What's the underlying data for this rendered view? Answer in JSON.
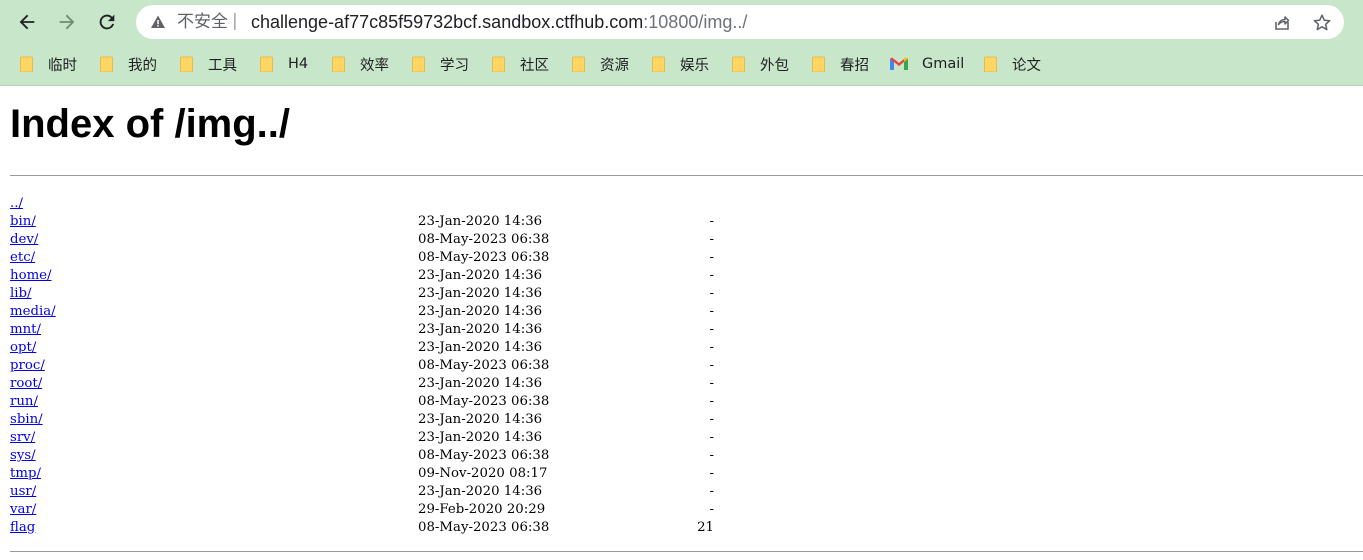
{
  "browser": {
    "security_label": "不安全",
    "url_host": "challenge-af77c85f59732bcf.sandbox.ctfhub.com",
    "url_rest": ":10800/img../",
    "bookmarks": [
      {
        "label": "临时",
        "icon": "folder-icon"
      },
      {
        "label": "我的",
        "icon": "folder-icon"
      },
      {
        "label": "工具",
        "icon": "folder-icon"
      },
      {
        "label": "H4",
        "icon": "folder-icon"
      },
      {
        "label": "效率",
        "icon": "folder-icon"
      },
      {
        "label": "学习",
        "icon": "folder-icon"
      },
      {
        "label": "社区",
        "icon": "folder-icon"
      },
      {
        "label": "资源",
        "icon": "folder-icon"
      },
      {
        "label": "娱乐",
        "icon": "folder-icon"
      },
      {
        "label": "外包",
        "icon": "folder-icon"
      },
      {
        "label": "春招",
        "icon": "folder-icon"
      },
      {
        "label": "Gmail",
        "icon": "gmail-icon"
      },
      {
        "label": "论文",
        "icon": "folder-icon"
      }
    ],
    "colors": {
      "toolbar": "#c8e6c9",
      "folder": "#fdd663",
      "link": "#0000ee"
    }
  },
  "page": {
    "title": "Index of /img../",
    "parent_link": "../",
    "entries": [
      {
        "name": "bin/",
        "date": "23-Jan-2020 14:36",
        "size": "-"
      },
      {
        "name": "dev/",
        "date": "08-May-2023 06:38",
        "size": "-"
      },
      {
        "name": "etc/",
        "date": "08-May-2023 06:38",
        "size": "-"
      },
      {
        "name": "home/",
        "date": "23-Jan-2020 14:36",
        "size": "-"
      },
      {
        "name": "lib/",
        "date": "23-Jan-2020 14:36",
        "size": "-"
      },
      {
        "name": "media/",
        "date": "23-Jan-2020 14:36",
        "size": "-"
      },
      {
        "name": "mnt/",
        "date": "23-Jan-2020 14:36",
        "size": "-"
      },
      {
        "name": "opt/",
        "date": "23-Jan-2020 14:36",
        "size": "-"
      },
      {
        "name": "proc/",
        "date": "08-May-2023 06:38",
        "size": "-"
      },
      {
        "name": "root/",
        "date": "23-Jan-2020 14:36",
        "size": "-"
      },
      {
        "name": "run/",
        "date": "08-May-2023 06:38",
        "size": "-"
      },
      {
        "name": "sbin/",
        "date": "23-Jan-2020 14:36",
        "size": "-"
      },
      {
        "name": "srv/",
        "date": "23-Jan-2020 14:36",
        "size": "-"
      },
      {
        "name": "sys/",
        "date": "08-May-2023 06:38",
        "size": "-"
      },
      {
        "name": "tmp/",
        "date": "09-Nov-2020 08:17",
        "size": "-"
      },
      {
        "name": "usr/",
        "date": "23-Jan-2020 14:36",
        "size": "-"
      },
      {
        "name": "var/",
        "date": "29-Feb-2020 20:29",
        "size": "-"
      },
      {
        "name": "flag",
        "date": "08-May-2023 06:38",
        "size": "21"
      }
    ]
  }
}
